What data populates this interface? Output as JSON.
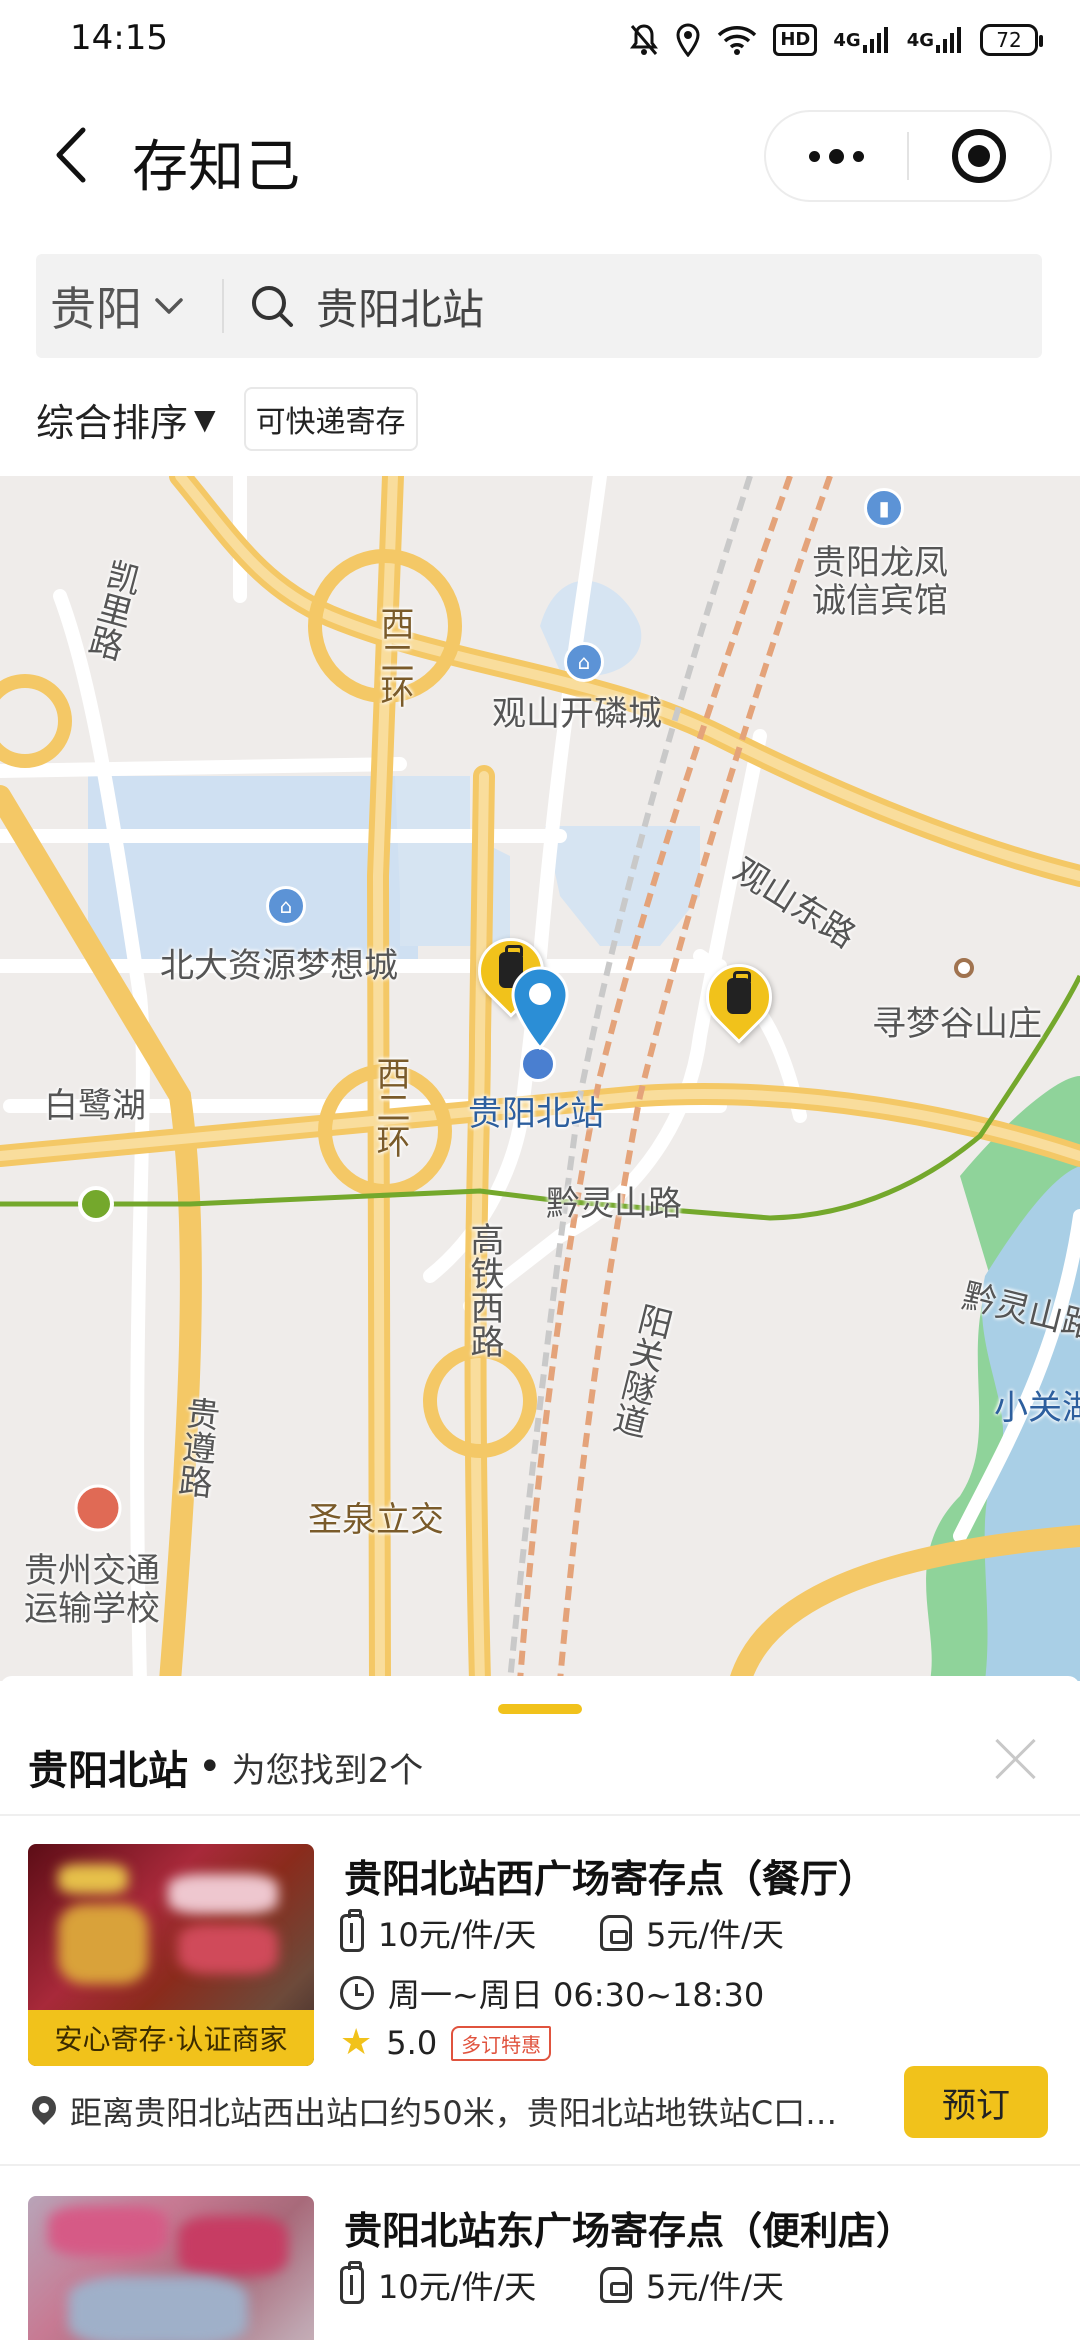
{
  "status_bar": {
    "time": "14:15",
    "network_1": "4G",
    "network_2": "4G",
    "hd_label": "HD",
    "battery": "72"
  },
  "title_bar": {
    "title": "存知己"
  },
  "search": {
    "city": "贵阳",
    "query": "贵阳北站"
  },
  "filters": {
    "sort_label": "综合排序",
    "sort_arrow": "▼",
    "express_chip": "可快递寄存"
  },
  "map": {
    "labels": {
      "kaili_road": "凯里路",
      "west_ring_1": "西二环",
      "west_ring_2": "西二环",
      "guanshan_city": "观山开磷城",
      "longfeng_hotel": "贵阳龙凤诚信宾馆",
      "guanshan_east_road": "观山东路",
      "mall": "北大资源梦想城",
      "xunmeng": "寻梦谷山庄",
      "bailu_lake": "白鹭湖",
      "station": "贵阳北站",
      "qianlingshan_road": "黔灵山路",
      "qianlingshan_road_2": "黔灵山路",
      "gaotie_west_road": "高铁西路",
      "yangguan_tunnel": "阳关隧道",
      "guizun_road": "贵遵路",
      "xiaoguan": "小关湖",
      "shengquan": "圣泉立交",
      "transport_school": "贵州交通运输学校"
    },
    "colors": {
      "road": "#f7d88a",
      "water": "#cfe0f2",
      "metro": "#74a82c",
      "rail": "#e4a37a",
      "pin": "#f1c21b",
      "location": "#2b8ed6"
    }
  },
  "sheet": {
    "title": "贵阳北站",
    "dot": "•",
    "subtitle": "为您找到2个"
  },
  "stores": [
    {
      "name": "贵阳北站西广场寄存点（餐厅）",
      "badge": "安心寄存·认证商家",
      "price_suitcase": "10元/件/天",
      "price_bag": "5元/件/天",
      "hours": "周一~周日 06:30~18:30",
      "rating": "5.0",
      "promo": "多订特惠",
      "address": "距离贵阳北站西出站口约50米，贵阳北站地铁站C口…",
      "book_label": "预订"
    },
    {
      "name": "贵阳北站东广场寄存点（便利店）",
      "price_suitcase": "10元/件/天",
      "price_bag": "5元/件/天"
    }
  ]
}
